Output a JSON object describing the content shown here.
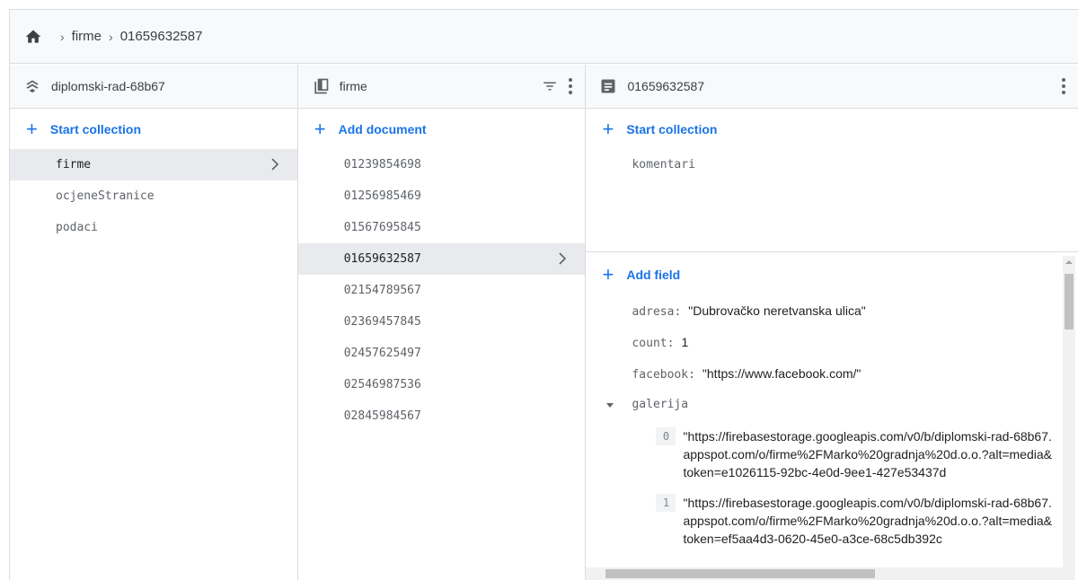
{
  "breadcrumb": {
    "items": [
      "firme",
      "01659632587"
    ]
  },
  "column1": {
    "header_title": "diplomski-rad-68b67",
    "add_label": "Start collection",
    "items": [
      "firme",
      "ocjeneStranice",
      "podaci"
    ],
    "selected": "firme"
  },
  "column2": {
    "header_title": "firme",
    "add_label": "Add document",
    "items": [
      "01239854698",
      "01256985469",
      "01567695845",
      "01659632587",
      "02154789567",
      "02369457845",
      "02457625497",
      "02546987536",
      "02845984567"
    ],
    "selected": "01659632587"
  },
  "column3": {
    "header_title": "01659632587",
    "add_collection_label": "Start collection",
    "subcollections": [
      "komentari"
    ],
    "add_field_label": "Add field",
    "fields": [
      {
        "key": "adresa",
        "value": "\"Dubrovačko neretvanska ulica\""
      },
      {
        "key": "count",
        "value": "1"
      },
      {
        "key": "facebook",
        "value": "\"https://www.facebook.com/\""
      }
    ],
    "map_field": {
      "key": "galerija",
      "items": [
        {
          "index": "0",
          "value": "\"https://firebasestorage.googleapis.com/v0/b/diplomski-rad-68b67.appspot.com/o/firme%2FMarko%20gradnja%20d.o.o.?alt=media&token=e1026115-92bc-4e0d-9ee1-427e53437d"
        },
        {
          "index": "1",
          "value": "\"https://firebasestorage.googleapis.com/v0/b/diplomski-rad-68b67.appspot.com/o/firme%2FMarko%20gradnja%20d.o.o.?alt=media&token=ef5aa4d3-0620-45e0-a3ce-68c5db392c"
        }
      ]
    }
  },
  "colors": {
    "accent": "#1a73e8",
    "selected_bg": "#e8eaed",
    "header_bg": "#f8f9fa",
    "border": "#dadce0"
  },
  "icons": {
    "home": "home-icon",
    "project": "firestore-project-icon",
    "collection": "collection-icon",
    "document": "document-icon",
    "filter": "filter-icon",
    "more": "more-vert-icon",
    "chevron": "chevron-right-icon",
    "expand": "expand-triangle-icon"
  }
}
